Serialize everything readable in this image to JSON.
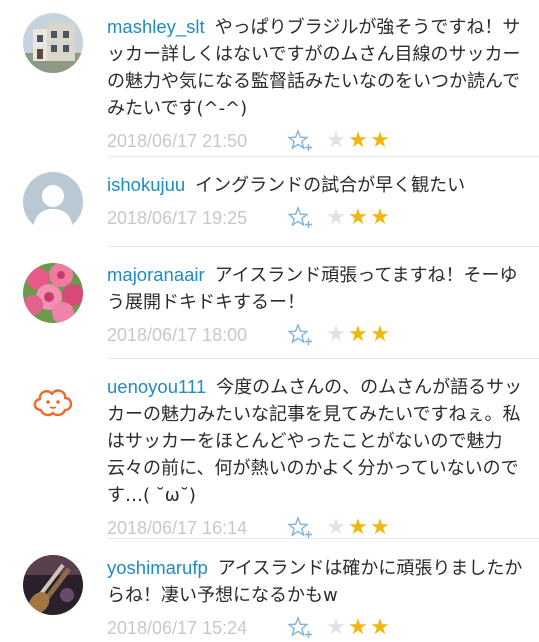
{
  "colors": {
    "username": "#1e8bc3",
    "timestamp": "#c8c8c8",
    "star_filled": "#f0b80f",
    "star_empty": "#e2e2e2",
    "fav_icon": "#7fb3de"
  },
  "comments": [
    {
      "username": "mashley_slt",
      "text": "やっぱりブラジルが強そうですね！サッカー詳しくはないですがのムさん目線のサッカーの魅力や気になる監督話みたいなのをいつか読んでみたいです(^-^)",
      "timestamp": "2018/06/17 21:50",
      "avatar": "house-photo",
      "star_glyphs": [
        "★",
        "★",
        "★"
      ],
      "rating": 2
    },
    {
      "username": "ishokujuu",
      "text": "イングランドの試合が早く観たい",
      "timestamp": "2018/06/17 19:25",
      "avatar": "default-person",
      "star_glyphs": [
        "★",
        "★",
        "★"
      ],
      "rating": 2
    },
    {
      "username": "majoranaair",
      "text": "アイスランド頑張ってますね！そーゆう展開ドキドキするー！",
      "timestamp": "2018/06/17 18:00",
      "avatar": "flowers-photo",
      "star_glyphs": [
        "★",
        "★",
        "★"
      ],
      "rating": 2
    },
    {
      "username": "uenoyou111",
      "text": "今度のムさんの、のムさんが語るサッカーの魅力みたいな記事を見てみたいですねぇ。私はサッカーをほとんどやったことがないので魅力云々の前に、何が熱いのかよく分かっていないのです…( ˘ω˘)",
      "timestamp": "2018/06/17 16:14",
      "avatar": "orange-face",
      "star_glyphs": [
        "★",
        "★",
        "★"
      ],
      "rating": 2
    },
    {
      "username": "yoshimarufp",
      "text": "アイスランドは確かに頑張りましたからね！凄い予想になるかもw",
      "timestamp": "2018/06/17 15:24",
      "avatar": "guitar-photo",
      "star_glyphs": [
        "★",
        "★",
        "★"
      ],
      "rating": 2
    }
  ]
}
